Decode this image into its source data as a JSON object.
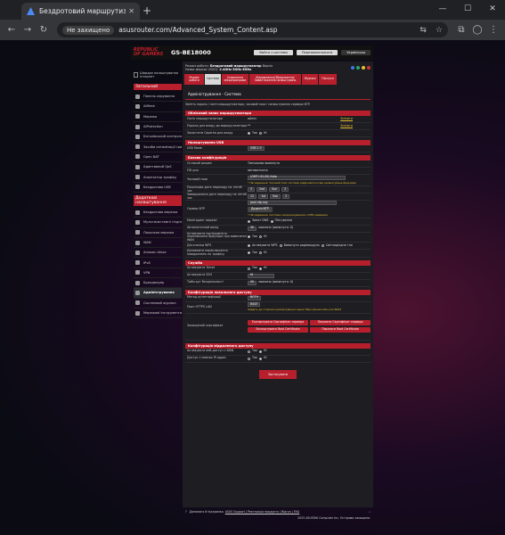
{
  "browser": {
    "tab_title": "Бездротовий маршрутизатор A",
    "security": "Не захищено",
    "url": "asusrouter.com/Advanced_System_Content.asp"
  },
  "router": {
    "brand": "REPUBLIC OF GAMERS",
    "model": "GS-BE18000",
    "logout": "Вийти з системи",
    "reboot": "Перезавантажити",
    "lang": "Українська"
  },
  "info": {
    "op_mode_label": "Режим роботи:",
    "op_mode": "Бездротовий маршрутизатор",
    "version_label": "Версія",
    "ssid_label": "Назва мережі (SSID):",
    "ssid": "2.4GHz 5GHz 6GHz"
  },
  "sidebar": {
    "quick": "Швидке налаштування інтернет",
    "general": "Загальний",
    "items": [
      "Панель керування",
      "AiMesh",
      "Мережа",
      "AiProtection",
      "Батьківський контроль",
      "Засоби оптимізації гри",
      "Open NAT",
      "Адаптивний QoS",
      "Аналізатор трафіку",
      "Бездротова USB"
    ],
    "advanced": "Додаткові налаштування",
    "adv_items": [
      "Бездротова мережа",
      "Мультисистемні з'єднання",
      "Локальна мережа",
      "WAN",
      "Amazon Alexa",
      "IPv6",
      "VPN",
      "Брандмауер",
      "Адміністрування",
      "Системний журнал",
      "Мережеві інструменти"
    ]
  },
  "tabs": [
    "Режим роботи",
    "Система",
    "Оновлення мікропрограми",
    "Відновлення/Збереження/Завантаження налаштувань",
    "Журнал",
    "Послуги"
  ],
  "page": {
    "title": "Адміністрування - Система",
    "desc": "Змініть пароль і логін маршрутизатора, часовий пояс і налаштування сервера NTP."
  },
  "s1": {
    "title": "Обліковий запис маршрутизатора",
    "r1": "Логін маршрутизатора",
    "r1v": "admin",
    "r2": "Пароль для входу до маршрутизатора",
    "r2v": "**",
    "mod": "Змінити",
    "r3": "Захистити Captcha для входу",
    "yes": "Так",
    "no": "Ні"
  },
  "s2": {
    "title": "Налаштування USB",
    "r1": "USB Mode",
    "r1v": "USB 2.0"
  },
  "s3": {
    "title": "Базова конфігурація",
    "sleep": "Сплячий режим",
    "sleep_v": "Тимчасово вимкнуто",
    "fw": "FW для",
    "fw_v": "автоматично",
    "tz": "Часовий пояс",
    "tz_v": "(GMT+02:00) Київ",
    "tz_note": "* Нагадування: Часовий пояс системи відрізняється від налаштувань браузера.",
    "dst1": "Початкова дата переходу на літній час",
    "dst2": "Завершальна дата переходу на літній час",
    "ntp": "Сервер NTP",
    "ntp_v": "pool.ntp.org",
    "ntp_link": "Додати NTP",
    "ntp_note": "* Нагадування: Система синхронізувалася з NTP-сервером.",
    "net": "Моніторинг мережі",
    "dns": "Запит DNS",
    "ping": "Пінгування",
    "auto": "Автоматичний вихід",
    "auto_v": "30",
    "minutes": "хвилини (вимкнути: 0)",
    "wps": "Активувати послідовність перемикання браузера при вимкненні WAN",
    "wpsbtn": "Дія кнопки WPS",
    "wps1": "Активувати WPS",
    "wps2": "Вимкнути радіомодуль",
    "wps3": "Світлодіодне тло",
    "remind": "Доповнити переключання повідомлень по трафіку"
  },
  "s4": {
    "title": "Служба",
    "telnet": "Активувати Telnet",
    "ssh": "Активувати SSH",
    "ssh_v": "Ні",
    "idle": "Тайм-аут бездіяльності",
    "idle_v": "20",
    "idle_u": "хвилини (вимкнути: 0)"
  },
  "s5": {
    "title": "Конфігурація локального доступу",
    "auth": "Метод аутентифікації",
    "auth_v": "BOTH",
    "port": "Порт HTTPS LAN",
    "port_v": "8443",
    "port_note": "Зайдіть до сторінки налаштування через https://asusrouter.com:8443",
    "cert": "Захищений сертифікат",
    "b1": "Експортувати Сертифікат сервера",
    "b2": "Показати Сертифікат сервера",
    "b3": "Експортувати Root Certificate",
    "b4": "Показати Root Certificate"
  },
  "s6": {
    "title": "Конфігурація віддаленого доступу",
    "r1": "Активувати веб-доступ з WAN",
    "r2": "Доступ з певних IP-адрес"
  },
  "apply": "Застосувати",
  "footer": {
    "help": "Допомога й підтримка",
    "links": "ASUS Support | Реєстрація продукту | Відгук | FAQ",
    "copy": "2025 ASUSTeK Computer Inc. Усі права захищено."
  }
}
